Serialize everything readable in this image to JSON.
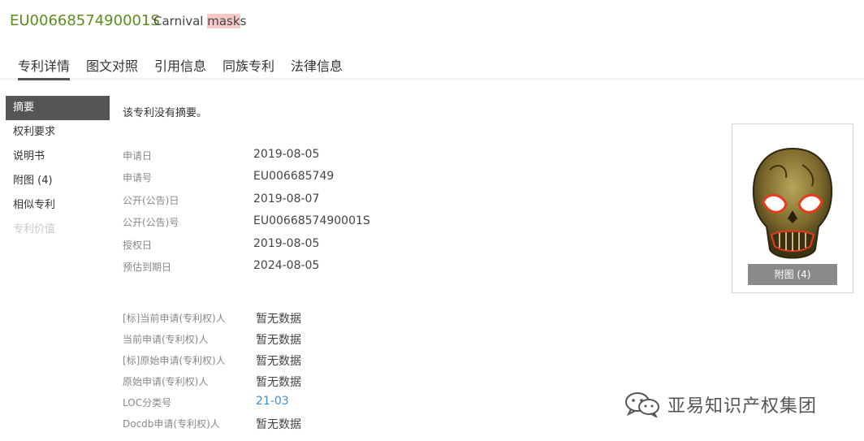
{
  "header": {
    "publication_number": "EU0066857490001S",
    "title_prefix": "Carnival ",
    "title_highlight": "mask",
    "title_suffix": "s"
  },
  "tabs": [
    {
      "label": "专利详情"
    },
    {
      "label": "图文对照"
    },
    {
      "label": "引用信息"
    },
    {
      "label": "同族专利"
    },
    {
      "label": "法律信息"
    }
  ],
  "sidebar": {
    "items": [
      {
        "label": "摘要"
      },
      {
        "label": "权利要求"
      },
      {
        "label": "说明书"
      },
      {
        "label": "附图 (4)"
      },
      {
        "label": "相似专利"
      },
      {
        "label": "专利价值"
      }
    ]
  },
  "abstract": {
    "text": "该专利没有摘要。"
  },
  "details": [
    {
      "label": "申请日",
      "value": "2019-08-05"
    },
    {
      "label": "申请号",
      "value": "EU006685749"
    },
    {
      "label": "公开(公告)日",
      "value": "2019-08-07"
    },
    {
      "label": "公开(公告)号",
      "value": "EU0066857490001S"
    },
    {
      "label": "授权日",
      "value": "2019-08-05"
    },
    {
      "label": "预估到期日",
      "value": "2024-08-05"
    }
  ],
  "parties": [
    {
      "label": "[标]当前申请(专利权)人",
      "value": "暂无数据"
    },
    {
      "label": "当前申请(专利权)人",
      "value": "暂无数据"
    },
    {
      "label": "[标]原始申请(专利权)人",
      "value": "暂无数据"
    },
    {
      "label": "原始申请(专利权)人",
      "value": "暂无数据"
    },
    {
      "label": "LOC分类号",
      "value": "21-03"
    },
    {
      "label": "Docdb申请(专利权)人",
      "value": "暂无数据"
    }
  ],
  "figure": {
    "label": "附图 (4)"
  },
  "watermark": {
    "text": "亚易知识产权集团"
  },
  "colors": {
    "accent_green": "#5a8d1e",
    "link_blue": "#3b8ed2",
    "sidebar_active": "#555555"
  }
}
